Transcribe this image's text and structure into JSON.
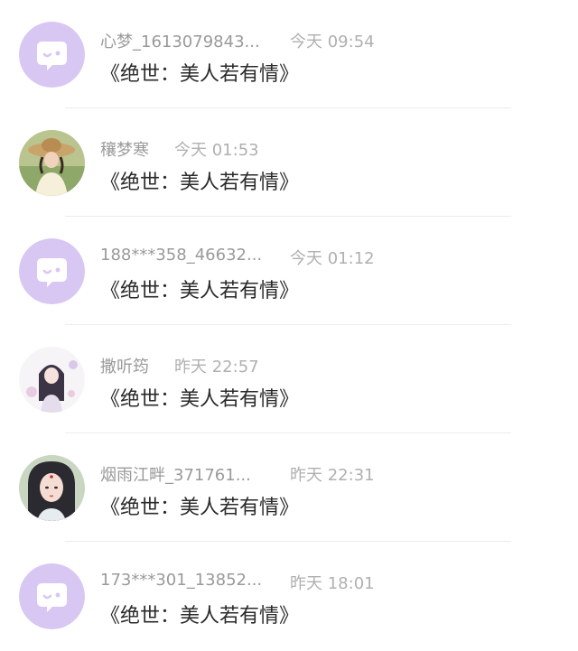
{
  "conversations": [
    {
      "name": "心梦_1613079843...",
      "time": "今天 09:54",
      "title": "《绝世：美人若有情》",
      "avatar": "default-chat-icon"
    },
    {
      "name": "穰梦寒",
      "time": "今天 01:53",
      "title": "《绝世：美人若有情》",
      "avatar": "user-photo"
    },
    {
      "name": "188***358_46632...",
      "time": "今天 01:12",
      "title": "《绝世：美人若有情》",
      "avatar": "default-chat-icon"
    },
    {
      "name": "撒听筠",
      "time": "昨天 22:57",
      "title": "《绝世：美人若有情》",
      "avatar": "illustrated-portrait"
    },
    {
      "name": "烟雨江畔_371761...",
      "time": "昨天 22:31",
      "title": "《绝世：美人若有情》",
      "avatar": "illustrated-portrait"
    },
    {
      "name": "173***301_13852...",
      "time": "昨天 18:01",
      "title": "《绝世：美人若有情》",
      "avatar": "default-chat-icon"
    }
  ],
  "colors": {
    "default_avatar_bg": "#d8c6f3",
    "name_text": "#9a9a9a",
    "time_text": "#b0b0b0",
    "title_text": "#2a2a2a"
  }
}
